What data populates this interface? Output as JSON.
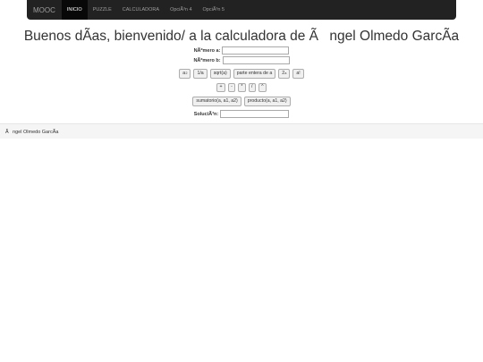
{
  "nav": {
    "brand": "MOOC",
    "items": [
      {
        "label": "INICIO",
        "active": true
      },
      {
        "label": "PUZZLE",
        "active": false
      },
      {
        "label": "CALCULADORA",
        "active": false
      },
      {
        "label": "OpciÃ³n 4",
        "active": false
      },
      {
        "label": "OpciÃ³n 5",
        "active": false
      }
    ]
  },
  "title": "Buenos dÃas, bienvenido/ a la calculadora de Ãngel Olmedo GarcÃa",
  "inputs": {
    "a_label": "NÃºmero a:",
    "b_label": "NÃºmero b:",
    "a_value": "",
    "b_value": ""
  },
  "unary_buttons": {
    "square_base": "a",
    "square_exp": "2",
    "inverse": "1/a",
    "sqrt": "sqrt(a)",
    "integer_part": "parte entera de a",
    "pow2_base": "2",
    "pow2_exp": "a",
    "factorial": "a!"
  },
  "binary_buttons": [
    "+",
    "-",
    "*",
    "/",
    "^"
  ],
  "list_buttons": {
    "sum": "sumatorio(a, a1, a2)",
    "product": "producto(a, a1, a2)"
  },
  "solution": {
    "label": "SoluciÃ³n:",
    "value": ""
  },
  "footer": {
    "text": "Ãngel Olmedo GarcÃa"
  }
}
